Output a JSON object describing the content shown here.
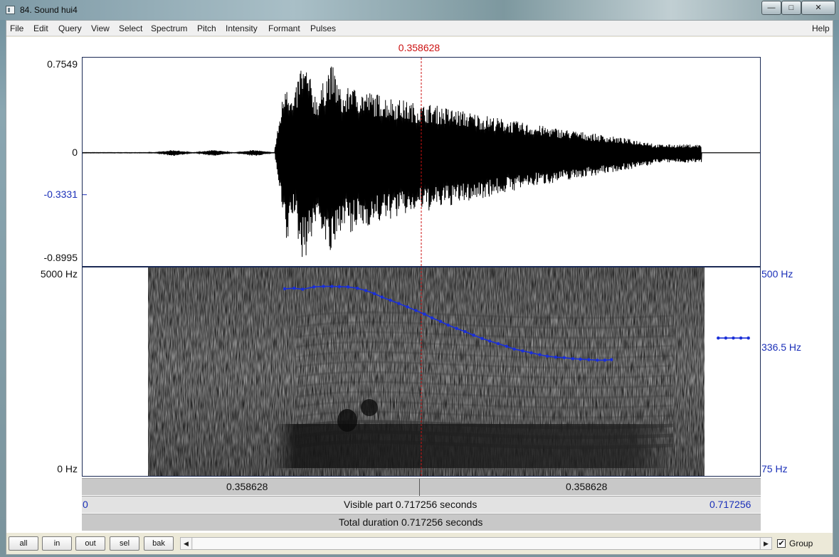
{
  "window": {
    "title": "84. Sound hui4",
    "minimize_glyph": "—",
    "maximize_glyph": "□",
    "close_glyph": "✕"
  },
  "menu": {
    "items": [
      "File",
      "Edit",
      "Query",
      "View",
      "Select",
      "Spectrum",
      "Pitch",
      "Intensity",
      "Formant",
      "Pulses"
    ],
    "help": "Help"
  },
  "cursor": {
    "time_label": "0.358628",
    "time_s": 0.358628,
    "color": "#cc1111"
  },
  "waveform": {
    "y_max_label": "0.7549",
    "y_zero_label": "0",
    "y_mid_label": "-0.3331",
    "y_min_label": "-0.8995",
    "y_max": 0.7549,
    "y_min": -0.8995,
    "y_mid": -0.3331
  },
  "spectrogram": {
    "freq_max_label": "5000 Hz",
    "freq_min_label": "0 Hz",
    "freq_max": 5000
  },
  "pitch": {
    "top_label": "500 Hz",
    "mid_label": "336.5 Hz",
    "bottom_label": "75 Hz",
    "max_hz": 500,
    "min_hz": 75,
    "color": "#1a2fd8",
    "points": [
      [
        0.214,
        412
      ],
      [
        0.224,
        414
      ],
      [
        0.233,
        410
      ],
      [
        0.245,
        419
      ],
      [
        0.255,
        421
      ],
      [
        0.264,
        421
      ],
      [
        0.272,
        420
      ],
      [
        0.281,
        419
      ],
      [
        0.291,
        414
      ],
      [
        0.3,
        405
      ],
      [
        0.309,
        394
      ],
      [
        0.317,
        382
      ],
      [
        0.326,
        371
      ],
      [
        0.335,
        360
      ],
      [
        0.344,
        349
      ],
      [
        0.353,
        338
      ],
      [
        0.362,
        327
      ],
      [
        0.37,
        316
      ],
      [
        0.379,
        306
      ],
      [
        0.387,
        296
      ],
      [
        0.396,
        287
      ],
      [
        0.405,
        279
      ],
      [
        0.414,
        270
      ],
      [
        0.423,
        262
      ],
      [
        0.431,
        256
      ],
      [
        0.44,
        250
      ],
      [
        0.449,
        244
      ],
      [
        0.457,
        238
      ],
      [
        0.466,
        234
      ],
      [
        0.475,
        230
      ],
      [
        0.484,
        226
      ],
      [
        0.492,
        223
      ],
      [
        0.501,
        221
      ],
      [
        0.51,
        220
      ],
      [
        0.519,
        218
      ],
      [
        0.527,
        217
      ],
      [
        0.536,
        216
      ],
      [
        0.545,
        215
      ],
      [
        0.553,
        215
      ],
      [
        0.56,
        216
      ]
    ],
    "points_tail": [
      [
        0.673,
        263
      ],
      [
        0.681,
        263
      ],
      [
        0.689,
        263
      ],
      [
        0.697,
        263
      ],
      [
        0.705,
        263
      ]
    ]
  },
  "timebar": {
    "left_label": "0.358628",
    "right_label": "0.358628",
    "visible_start": "0",
    "visible_text": "Visible part 0.717256 seconds",
    "visible_end": "0.717256",
    "total_text": "Total duration 0.717256 seconds",
    "duration_s": 0.717256
  },
  "buttons": {
    "all": "all",
    "in": "in",
    "out": "out",
    "sel": "sel",
    "bak": "bak"
  },
  "scroll": {
    "left_glyph": "◀",
    "right_glyph": "▶"
  },
  "group": {
    "label": "Group",
    "checked": true,
    "check_glyph": "✔"
  }
}
